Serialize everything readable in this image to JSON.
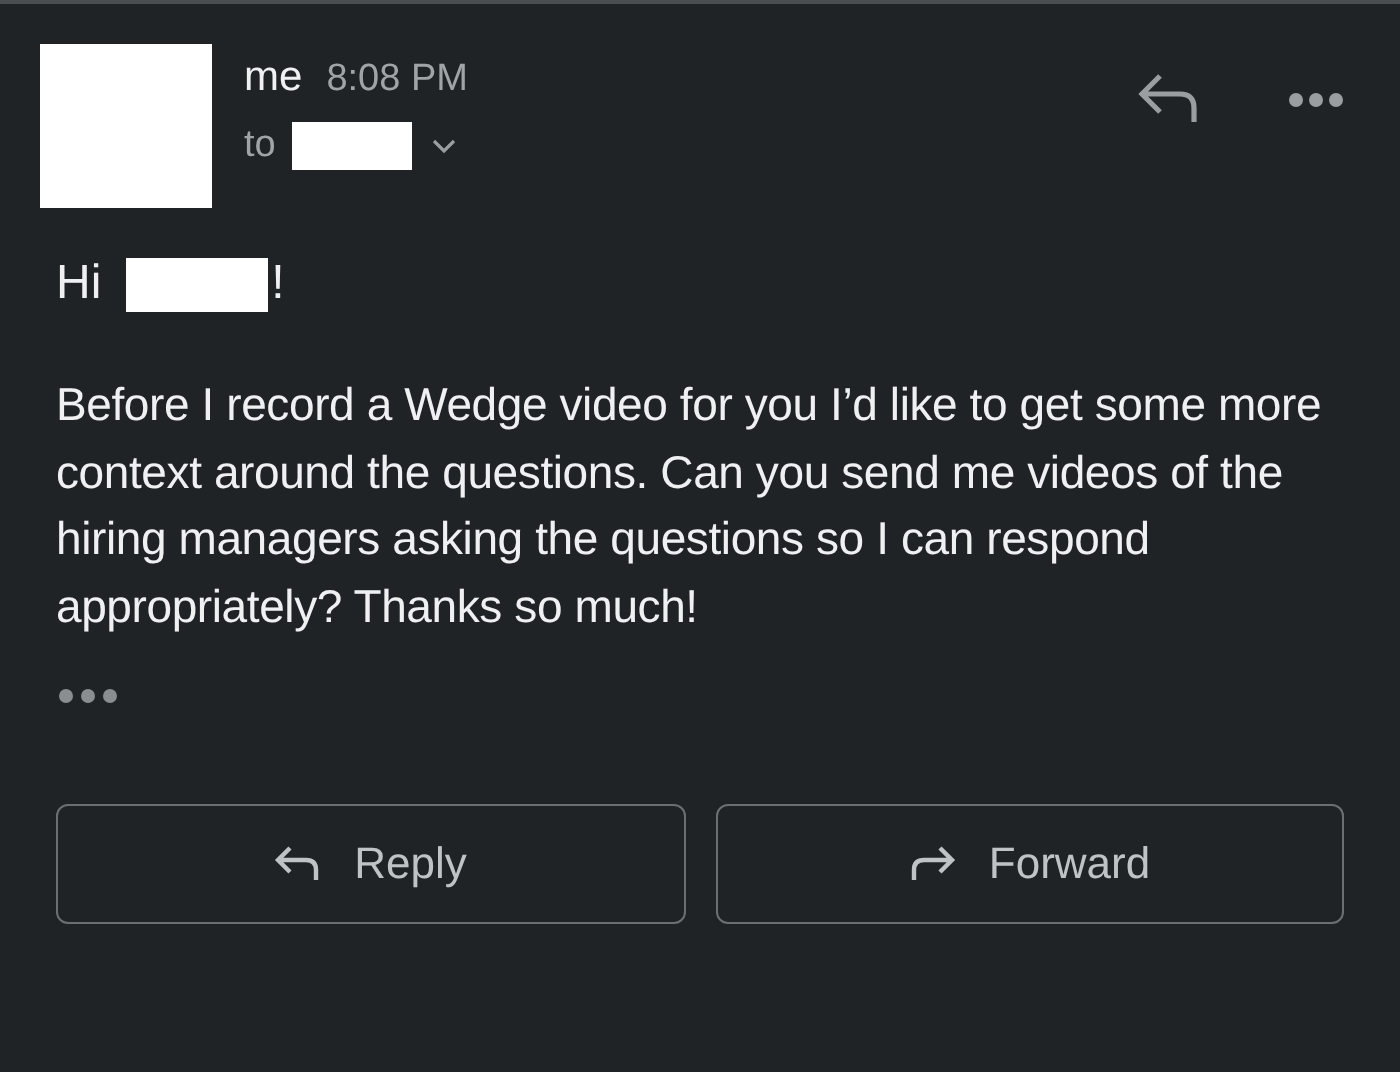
{
  "header": {
    "sender": "me",
    "time": "8:08 PM",
    "to_label": "to"
  },
  "greeting": {
    "word": "Hi",
    "end": "!"
  },
  "body": "Before I record a Wedge video for you I’d like to get some more context around the questions. Can you send me videos of the hiring managers asking the questions so I can respond appropriately? Thanks so much!",
  "buttons": [
    {
      "kind": "reply",
      "label": "Reply"
    },
    {
      "kind": "forward",
      "label": "Forward"
    }
  ]
}
